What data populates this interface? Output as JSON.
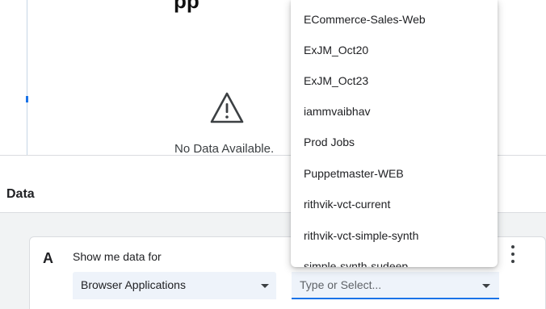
{
  "header": {
    "title_fragment": "pp",
    "no_data_text": "No Data Available."
  },
  "data_section": {
    "title": "Data"
  },
  "query": {
    "letter": "A",
    "show_me_label": "Show me data for",
    "source_select_value": "Browser Applications",
    "entity_placeholder": "Type or Select..."
  },
  "dropdown": {
    "options": [
      "ECommerce-Sales-Web",
      "ExJM_Oct20",
      "ExJM_Oct23",
      "iammvaibhav",
      "Prod Jobs",
      "Puppetmaster-WEB",
      "rithvik-vct-current",
      "rithvik-vct-simple-synth",
      "simple-synth-sudeep"
    ]
  },
  "colors": {
    "accent": "#1a73e8",
    "select_bg": "#eef3fa",
    "section_bg": "#f1f3f4"
  },
  "icons": {
    "warning": "warning-icon",
    "caret": "chevron-down-icon",
    "menu": "more-vert-icon"
  }
}
